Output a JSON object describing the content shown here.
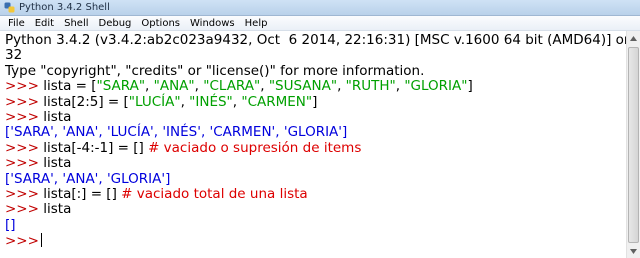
{
  "window": {
    "title": "Python 3.4.2 Shell",
    "icon": "python-icon"
  },
  "menu": [
    "File",
    "Edit",
    "Shell",
    "Debug",
    "Options",
    "Windows",
    "Help"
  ],
  "colors": {
    "prompt": "#c00000",
    "string": "#00a000",
    "output": "#0000dd",
    "comment": "#dd0000"
  },
  "shell": {
    "banner1": "Python 3.4.2 (v3.4.2:ab2c023a9432, Oct  6 2014, 22:16:31) [MSC v.1600 64 bit (AMD64)] on win",
    "banner2": "32",
    "banner3": "Type \"copyright\", \"credits\" or \"license()\" for more information.",
    "prompt": ">>> ",
    "prompt_final": ">>>",
    "l1_code": "lista = [",
    "l1_s1": "\"SARA\"",
    "l1_s2": "\"ANA\"",
    "l1_s3": "\"CLARA\"",
    "l1_s4": "\"SUSANA\"",
    "l1_s5": "\"RUTH\"",
    "l1_s6": "\"GLORIA\"",
    "comma": ", ",
    "close": "]",
    "l2_code": "lista[2:5] = [",
    "l2_s1": "\"LUCÍA\"",
    "l2_s2": "\"INÉS\"",
    "l2_s3": "\"CARMEN\"",
    "l3_code": "lista",
    "out1": "['SARA', 'ANA', 'LUCÍA', 'INÉS', 'CARMEN', 'GLORIA']",
    "l4_code": "lista[-4:-1] = [] ",
    "l4_comment": "# vaciado o supresión de items",
    "l5_code": "lista",
    "out2": "['SARA', 'ANA', 'GLORIA']",
    "l6_code": "lista[:] = [] ",
    "l6_comment": "# vaciado total de una lista",
    "l7_code": "lista",
    "out3": "[]"
  }
}
